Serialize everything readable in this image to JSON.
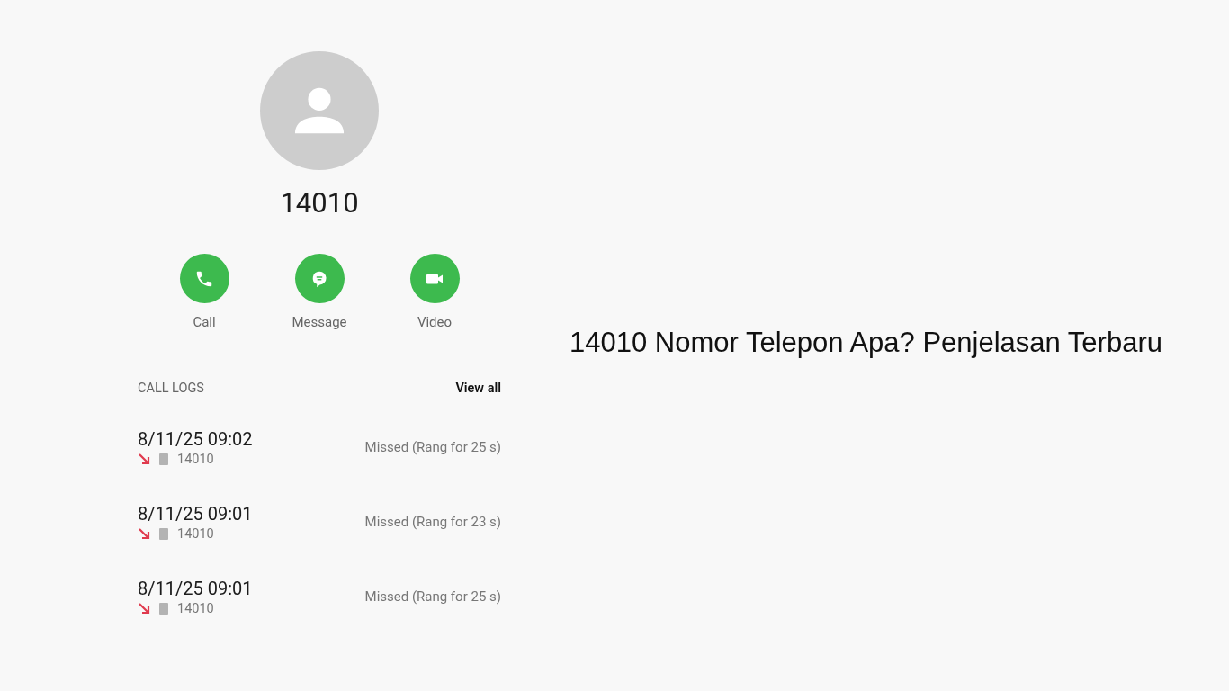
{
  "contact": {
    "number": "14010"
  },
  "actions": [
    {
      "kind": "call",
      "label": "Call"
    },
    {
      "kind": "message",
      "label": "Message"
    },
    {
      "kind": "video",
      "label": "Video"
    }
  ],
  "call_logs": {
    "title": "CALL LOGS",
    "view_all": "View all",
    "entries": [
      {
        "datetime": "8/11/25 09:02",
        "missed": true,
        "number": "14010",
        "detail": "Missed (Rang for 25 s)"
      },
      {
        "datetime": "8/11/25 09:01",
        "missed": true,
        "number": "14010",
        "detail": "Missed (Rang for 23 s)"
      },
      {
        "datetime": "8/11/25 09:01",
        "missed": true,
        "number": "14010",
        "detail": "Missed (Rang for 25 s)"
      }
    ]
  },
  "headline": "14010 Nomor Telepon Apa? Penjelasan Terbaru"
}
